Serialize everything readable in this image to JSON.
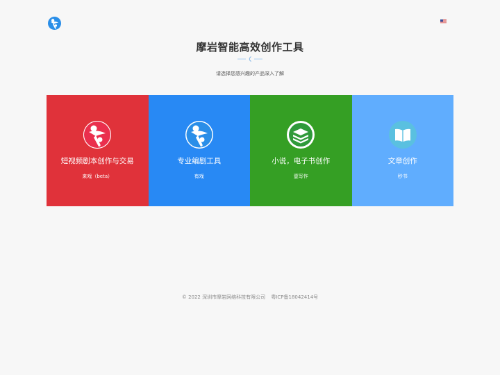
{
  "header": {
    "logo_icon": "ant-mascot-icon",
    "language_flag_icon": "us-flag-icon"
  },
  "hero": {
    "title": "摩岩智能高效创作工具",
    "divider_icon": "ornament-divider-icon",
    "subtitle": "请选择您感兴趣的产品深入了解"
  },
  "products": [
    {
      "name": "短视频剧本创作与交易",
      "sub": "来戏（beta）",
      "color": "#e0323a",
      "icon": "ant-mascot-icon"
    },
    {
      "name": "专业编剧工具",
      "sub": "有戏",
      "color": "#2889f4",
      "icon": "ant-mascot-icon"
    },
    {
      "name": "小说，电子书创作",
      "sub": "壹写作",
      "color": "#359f24",
      "icon": "book-stack-icon"
    },
    {
      "name": "文章创作",
      "sub": "秒书",
      "color": "#60adfe",
      "icon": "open-book-icon"
    }
  ],
  "footer": {
    "copyright": "© 2022 深圳市摩岩网络科技有限公司",
    "icp": "粤ICP备18042414号"
  }
}
